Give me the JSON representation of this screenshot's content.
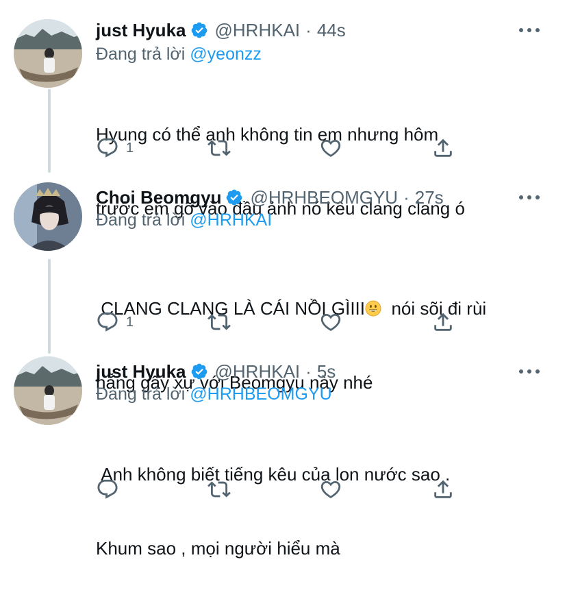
{
  "tweets": [
    {
      "display_name": "just Hyuka",
      "handle": "@HRHKAI",
      "separator": "·",
      "time": "44s",
      "replying_prefix": "Đang trả lời",
      "replying_to": "@yeonzz",
      "text_line1": "Hyung có thể anh không tin em nhưng hôm",
      "text_line2": "trước em gõ vào đầu ảnh nó kêu clang clang ó",
      "reply_count": "1",
      "avatar_icon": "avatar-hyuka-boat"
    },
    {
      "display_name": "Choi Beomgyu",
      "handle": "@HRHBEOMGYU",
      "separator": "·",
      "time": "27s",
      "replying_prefix": "Đang trả lời",
      "replying_to": "@HRHKAI",
      "text_before_emoji": " CLANG CLANG LÀ CÁI NỒI GÌIII",
      "text_after_emoji": "  nói sõi đi rùi",
      "text_line2": "hẵng gây xự với Beomgyu này nhé",
      "reply_count": "1",
      "avatar_icon": "avatar-beomgyu-crown"
    },
    {
      "display_name": "just Hyuka",
      "handle": "@HRHKAI",
      "separator": "·",
      "time": "5s",
      "replying_prefix": "Đang trả lời",
      "replying_to": "@HRHBEOMGYU",
      "text_line1": " Anh không biết tiếng kêu của lon nước sao .",
      "text_line2": "Khum sao , mọi người hiểu mà",
      "reply_count": "",
      "avatar_icon": "avatar-hyuka-boat"
    }
  ],
  "icons": {
    "verified": "verified-badge-icon",
    "more": "more-dots-icon",
    "reply": "reply-icon",
    "retweet": "retweet-icon",
    "like": "like-icon",
    "share": "share-icon",
    "emoji": "grinning-face-emoji"
  },
  "colors": {
    "link": "#1d9bf0",
    "secondary_text": "#536471",
    "thread_line": "#cfd9de",
    "verified": "#1d9bf0"
  }
}
